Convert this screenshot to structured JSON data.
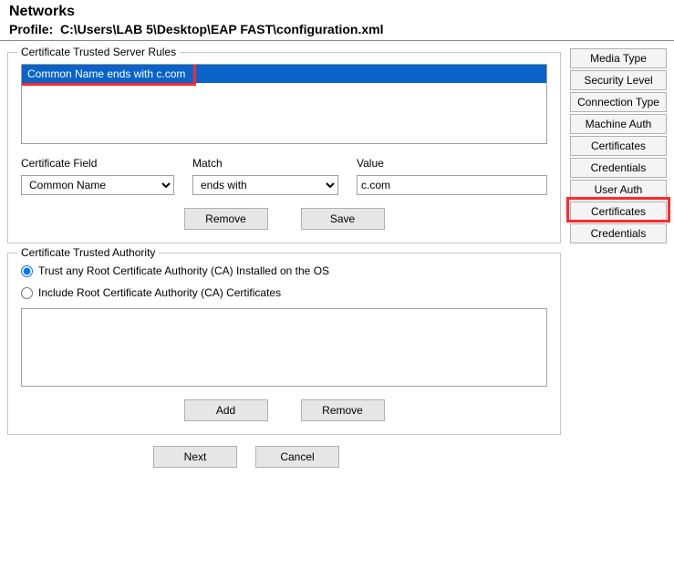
{
  "header": {
    "title": "Networks",
    "profile_label": "Profile:",
    "profile_path": "C:\\Users\\LAB 5\\Desktop\\EAP FAST\\configuration.xml"
  },
  "side": {
    "items": [
      "Media Type",
      "Security Level",
      "Connection Type",
      "Machine Auth",
      "Certificates",
      "Credentials",
      "User Auth",
      "Certificates",
      "Credentials"
    ],
    "highlight_index": 7
  },
  "rules": {
    "legend": "Certificate Trusted Server Rules",
    "list": [
      "Common Name ends with c.com"
    ],
    "labels": {
      "field": "Certificate Field",
      "match": "Match",
      "value": "Value"
    },
    "field_options": [
      "Common Name"
    ],
    "field_selected": "Common Name",
    "match_options": [
      "ends with"
    ],
    "match_selected": "ends with",
    "value": "c.com",
    "buttons": {
      "remove": "Remove",
      "save": "Save"
    }
  },
  "authority": {
    "legend": "Certificate Trusted Authority",
    "option_trust_any": "Trust any Root Certificate Authority (CA) Installed on the OS",
    "option_include": "Include Root Certificate Authority (CA) Certificates",
    "selected": "trust_any",
    "buttons": {
      "add": "Add",
      "remove": "Remove"
    }
  },
  "footer": {
    "next": "Next",
    "cancel": "Cancel"
  }
}
